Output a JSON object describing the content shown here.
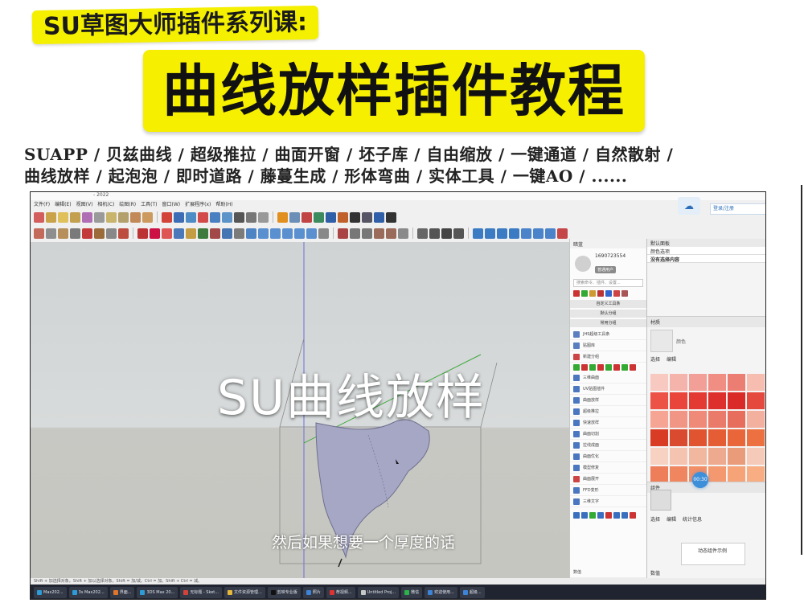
{
  "banner": {
    "series_title": "SU草图大师插件系列课:",
    "main_title": "曲线放样插件教程",
    "features_line1": "SUAPP / 贝兹曲线 / 超级推拉 / 曲面开窗 / 坯子库 / 自由缩放 / 一键通道 / 自然散射 /",
    "features_line2": "曲线放样 / 起泡泡 / 即时道路 / 藤蔓生成 / 形体弯曲 / 实体工具 / 一键AO / ......"
  },
  "app": {
    "title_suffix": "- 2022",
    "menus": [
      "文件(F)",
      "编辑(E)",
      "视图(V)",
      "相机(C)",
      "绘图(R)",
      "工具(T)",
      "窗口(W)",
      "扩展程序(x)",
      "帮助(H)"
    ],
    "login_text": "登录/注册"
  },
  "viewport": {
    "overlay_title": "SU曲线放样",
    "subtitle": "然后如果想要一个厚度的话"
  },
  "plugin_panel": {
    "header": "暗蓝",
    "user_id": "1690723554",
    "user_badge": "普通用户",
    "search_placeholder": "搜索命令、插件、设置...",
    "groups": [
      "自定义工具条",
      "默认分组",
      "常用分组"
    ],
    "items": [
      "JHS超级工具条",
      "贴图库",
      "新建分组",
      "三维曲面",
      "UV贴图插件",
      "曲面放样",
      "超级推拉",
      "快速放样",
      "曲面切割",
      "拉线成面",
      "曲面优化",
      "模型修复",
      "曲面展开",
      "FFD变形",
      "三维文字"
    ],
    "bottom_label": "数值"
  },
  "tray": {
    "title": "默认面板",
    "style_header": "颜色选项",
    "no_selection": "没有选择内容",
    "section_material": "材质",
    "material_name": "颜色",
    "tabs": [
      "选择",
      "编辑"
    ],
    "section_components": "组件",
    "component_tabs": [
      "选择",
      "编辑",
      "统计信息"
    ],
    "component_preview_label": "动态组件示例",
    "bottom_label": "数值",
    "bubble_label": "00:30"
  },
  "statusbar": {
    "text": "Shift + 加选择对象。Shift + 加以选择对象。Shift = 加/减。Ctrl = 加。Shift + Ctrl = 减。"
  },
  "taskbar": {
    "items": [
      "Max202...",
      "3s Max202...",
      "界面...",
      "3DS Max 20...",
      "无标题 - Sket...",
      "文件资源管理...",
      "剪映专业版",
      "照片",
      "荐视频...",
      "Untitled Proj...",
      "微信",
      "欢迎使用...",
      "超级..."
    ]
  },
  "colors": {
    "banner_yellow": "#f6ef00",
    "accent_blue": "#3e8fd9",
    "swatches": [
      "#f7c9c0",
      "#f4b3ab",
      "#f2a097",
      "#f08e84",
      "#ec7d73",
      "#f7bdb1",
      "#ed5246",
      "#e9453a",
      "#e33a33",
      "#dd2f2b",
      "#d92a27",
      "#e5483d",
      "#f6a595",
      "#f19685",
      "#ef8a79",
      "#ea7a69",
      "#e76d5c",
      "#f3b09f",
      "#d83c24",
      "#d94a2e",
      "#e0552f",
      "#e45d34",
      "#e8663a",
      "#ec7040",
      "#f7d2c2",
      "#f4c4b1",
      "#f1b79f",
      "#eeaa8e",
      "#ea9b7a",
      "#f5cab8",
      "#ee7e59",
      "#f08660",
      "#f28f67",
      "#f4996f",
      "#f6a378",
      "#f8ae82"
    ]
  }
}
